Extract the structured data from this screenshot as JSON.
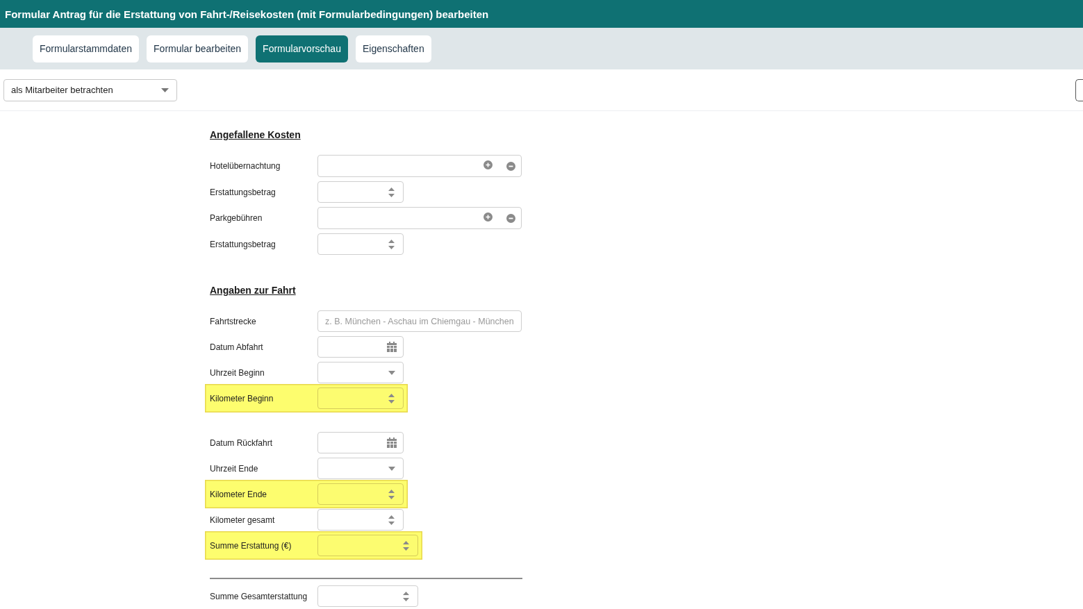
{
  "window": {
    "title": "Formular Antrag für die Erstattung von Fahrt-/Reisekosten (mit Formularbedingungen) bearbeiten"
  },
  "tabs": [
    {
      "label": "Formularstammdaten",
      "selected": false
    },
    {
      "label": "Formular bearbeiten",
      "selected": false
    },
    {
      "label": "Formularvorschau",
      "selected": true
    },
    {
      "label": "Eigenschaften",
      "selected": false
    }
  ],
  "view_select": {
    "value": "als Mitarbeiter betrachten"
  },
  "sections": [
    {
      "heading": "Angefallene Kosten",
      "groups": [
        {
          "fields": [
            {
              "label": "Hotelübernachtung",
              "kind": "list",
              "highlighted": false
            },
            {
              "label": "Erstattungsbetrag",
              "kind": "number",
              "highlighted": false
            },
            {
              "label": "Parkgebühren",
              "kind": "list",
              "highlighted": false
            },
            {
              "label": "Erstattungsbetrag",
              "kind": "number",
              "highlighted": false
            }
          ]
        }
      ]
    },
    {
      "heading": "Angaben zur Fahrt",
      "groups": [
        {
          "fields": [
            {
              "label": "Fahrtstrecke",
              "kind": "text",
              "placeholder": "z. B. München - Aschau im Chiemgau - München",
              "highlighted": false
            },
            {
              "label": "Datum Abfahrt",
              "kind": "date",
              "highlighted": false
            },
            {
              "label": "Uhrzeit Beginn",
              "kind": "time",
              "highlighted": false
            },
            {
              "label": "Kilometer Beginn",
              "kind": "number",
              "highlighted": true
            }
          ]
        },
        {
          "fields": [
            {
              "label": "Datum Rückfahrt",
              "kind": "date",
              "highlighted": false
            },
            {
              "label": "Uhrzeit Ende",
              "kind": "time",
              "highlighted": false
            },
            {
              "label": "Kilometer Ende",
              "kind": "number",
              "highlighted": true
            },
            {
              "label": "Kilometer gesamt",
              "kind": "number",
              "highlighted": false
            },
            {
              "label": "Summe Erstattung (€)",
              "kind": "currency",
              "highlighted": true
            }
          ]
        }
      ]
    }
  ],
  "summary": {
    "fields": [
      {
        "label": "Summe Gesamterstattung",
        "kind": "currency",
        "highlighted": false
      }
    ]
  }
}
